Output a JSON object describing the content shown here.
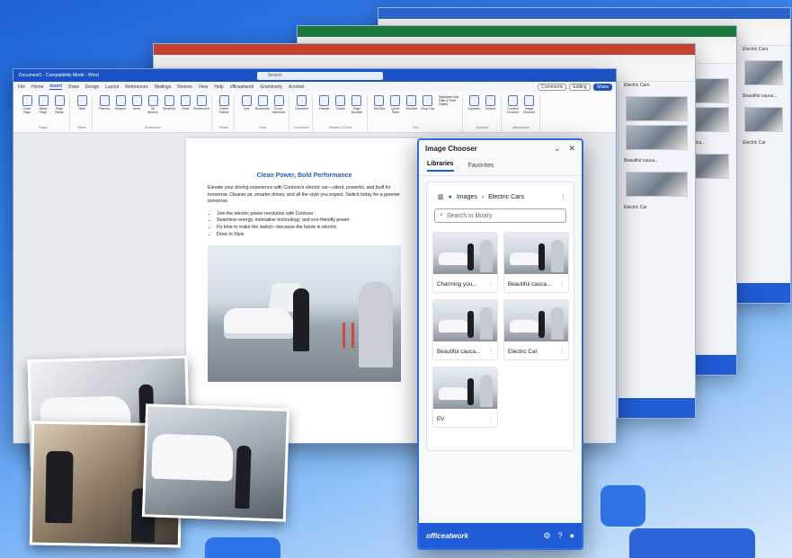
{
  "word": {
    "title": "Document1 - Compatibility Mode - Word",
    "search_placeholder": "Search",
    "tabs": [
      "File",
      "Home",
      "Insert",
      "Draw",
      "Design",
      "Layout",
      "References",
      "Mailings",
      "Review",
      "View",
      "Help",
      "officeatwork",
      "Grammarly",
      "Acrobat"
    ],
    "selected_tab": "Insert",
    "comments_label": "Comments",
    "editing_label": "Editing",
    "share_label": "Share",
    "ribbon_groups": [
      {
        "label": "Pages",
        "buttons": [
          "Cover Page",
          "Blank Page",
          "Page Break"
        ]
      },
      {
        "label": "Tables",
        "buttons": [
          "Table"
        ]
      },
      {
        "label": "Illustrations",
        "buttons": [
          "Pictures",
          "Shapes",
          "Icons",
          "3D Models",
          "SmartArt",
          "Chart",
          "Screenshot"
        ]
      },
      {
        "label": "Media",
        "buttons": [
          "Online Videos"
        ]
      },
      {
        "label": "Links",
        "buttons": [
          "Link",
          "Bookmark",
          "Cross-reference"
        ]
      },
      {
        "label": "Comments",
        "buttons": [
          "Comment"
        ]
      },
      {
        "label": "Header & Footer",
        "buttons": [
          "Header",
          "Footer",
          "Page Number"
        ]
      },
      {
        "label": "Text",
        "buttons": [
          "Text Box",
          "Quick Parts",
          "WordArt",
          "Drop Cap"
        ]
      },
      {
        "label": "Symbols",
        "buttons": [
          "Equation",
          "Symbol"
        ]
      },
      {
        "label": "officeatwork",
        "buttons": [
          "Content Chooser",
          "Image Chooser"
        ]
      }
    ],
    "text_group_extras": [
      "Signature Line",
      "Date & Time",
      "Object"
    ],
    "document": {
      "heading": "Clean Power, Bold Performance",
      "paragraph": "Elevate your driving experience with Contoso's electric car—silent, powerful, and built for tomorrow. Cleaner air, smarter drives, and all the style you expect. Switch today for a greener tomorrow.",
      "bullets": [
        "Join the electric power revolution with Contoso",
        "Seamless energy, innovative technology, and eco-friendly power",
        "It's time to make the switch—because the future is electric",
        "Drive in Style"
      ]
    }
  },
  "pane": {
    "title": "Image Chooser",
    "tabs": [
      "Libraries",
      "Favorites"
    ],
    "active_tab": "Libraries",
    "breadcrumb_root": "Images",
    "breadcrumb_current": "Electric Cars",
    "search_placeholder": "Search in library",
    "images": [
      {
        "label": "Charming you..."
      },
      {
        "label": "Beautiful cauca..."
      },
      {
        "label": "Beautiful cauca..."
      },
      {
        "label": "Electric Car"
      },
      {
        "label": "EV"
      }
    ],
    "brand": "officeatwork"
  },
  "back_windows": {
    "w1_captions": [
      "Electric Cars",
      "Beautiful cauca...",
      "Electric Car"
    ],
    "w2_captions": [
      "Electric Cars",
      "Beautiful cauca...",
      "Electric Car"
    ]
  },
  "colors": {
    "word_blue": "#1b51c3",
    "excel_green": "#1e7a3c",
    "powerpoint_red": "#c4432c",
    "pane_accent": "#1f5cd6"
  }
}
